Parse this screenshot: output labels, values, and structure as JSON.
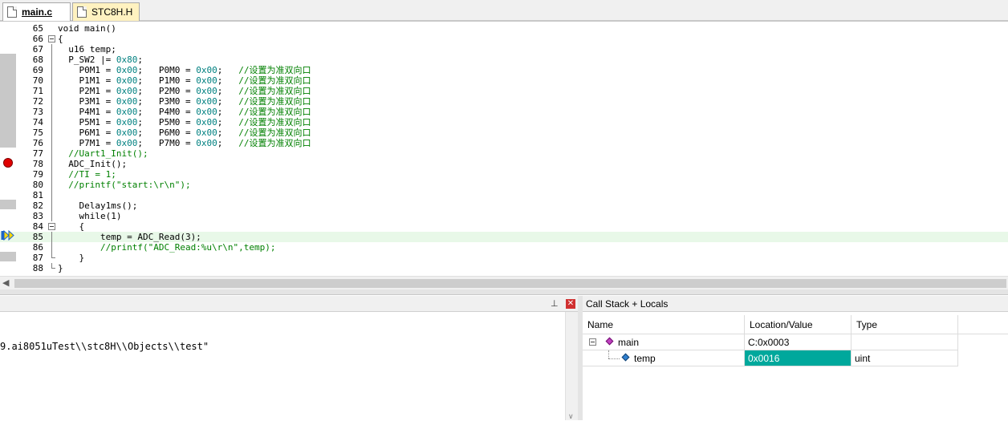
{
  "tabs": [
    {
      "label": "main.c",
      "active": true
    },
    {
      "label": "STC8H.H",
      "active": false
    }
  ],
  "editor": {
    "current_line": 85,
    "breakpoint_line": 78,
    "lines": [
      {
        "n": "65",
        "fold": "",
        "tokens": [
          [
            "n",
            "void main()"
          ]
        ]
      },
      {
        "n": "66",
        "fold": "box",
        "tokens": [
          [
            "n",
            "{"
          ]
        ]
      },
      {
        "n": "67",
        "fold": "bar",
        "tokens": [
          [
            "n",
            "  u16 temp;"
          ]
        ]
      },
      {
        "n": "68",
        "fold": "bar",
        "tokens": [
          [
            "n",
            "  P_SW2 |= "
          ],
          [
            "h",
            "0x80"
          ],
          [
            "n",
            ";"
          ]
        ]
      },
      {
        "n": "69",
        "fold": "bar",
        "tokens": [
          [
            "n",
            "    P0M1 = "
          ],
          [
            "h",
            "0x00"
          ],
          [
            "n",
            ";   P0M0 = "
          ],
          [
            "h",
            "0x00"
          ],
          [
            "n",
            ";   "
          ],
          [
            "c",
            "//设置为准双向口"
          ]
        ]
      },
      {
        "n": "70",
        "fold": "bar",
        "tokens": [
          [
            "n",
            "    P1M1 = "
          ],
          [
            "h",
            "0x00"
          ],
          [
            "n",
            ";   P1M0 = "
          ],
          [
            "h",
            "0x00"
          ],
          [
            "n",
            ";   "
          ],
          [
            "c",
            "//设置为准双向口"
          ]
        ]
      },
      {
        "n": "71",
        "fold": "bar",
        "tokens": [
          [
            "n",
            "    P2M1 = "
          ],
          [
            "h",
            "0x00"
          ],
          [
            "n",
            ";   P2M0 = "
          ],
          [
            "h",
            "0x00"
          ],
          [
            "n",
            ";   "
          ],
          [
            "c",
            "//设置为准双向口"
          ]
        ]
      },
      {
        "n": "72",
        "fold": "bar",
        "tokens": [
          [
            "n",
            "    P3M1 = "
          ],
          [
            "h",
            "0x00"
          ],
          [
            "n",
            ";   P3M0 = "
          ],
          [
            "h",
            "0x00"
          ],
          [
            "n",
            ";   "
          ],
          [
            "c",
            "//设置为准双向口"
          ]
        ]
      },
      {
        "n": "73",
        "fold": "bar",
        "tokens": [
          [
            "n",
            "    P4M1 = "
          ],
          [
            "h",
            "0x00"
          ],
          [
            "n",
            ";   P4M0 = "
          ],
          [
            "h",
            "0x00"
          ],
          [
            "n",
            ";   "
          ],
          [
            "c",
            "//设置为准双向口"
          ]
        ]
      },
      {
        "n": "74",
        "fold": "bar",
        "tokens": [
          [
            "n",
            "    P5M1 = "
          ],
          [
            "h",
            "0x00"
          ],
          [
            "n",
            ";   P5M0 = "
          ],
          [
            "h",
            "0x00"
          ],
          [
            "n",
            ";   "
          ],
          [
            "c",
            "//设置为准双向口"
          ]
        ]
      },
      {
        "n": "75",
        "fold": "bar",
        "tokens": [
          [
            "n",
            "    P6M1 = "
          ],
          [
            "h",
            "0x00"
          ],
          [
            "n",
            ";   P6M0 = "
          ],
          [
            "h",
            "0x00"
          ],
          [
            "n",
            ";   "
          ],
          [
            "c",
            "//设置为准双向口"
          ]
        ]
      },
      {
        "n": "76",
        "fold": "bar",
        "tokens": [
          [
            "n",
            "    P7M1 = "
          ],
          [
            "h",
            "0x00"
          ],
          [
            "n",
            ";   P7M0 = "
          ],
          [
            "h",
            "0x00"
          ],
          [
            "n",
            ";   "
          ],
          [
            "c",
            "//设置为准双向口"
          ]
        ]
      },
      {
        "n": "77",
        "fold": "bar",
        "tokens": [
          [
            "c",
            "  //Uart1_Init();"
          ]
        ]
      },
      {
        "n": "78",
        "fold": "bar",
        "tokens": [
          [
            "n",
            "  ADC_Init();"
          ]
        ]
      },
      {
        "n": "79",
        "fold": "bar",
        "tokens": [
          [
            "c",
            "  //TI = 1;"
          ]
        ]
      },
      {
        "n": "80",
        "fold": "bar",
        "tokens": [
          [
            "c",
            "  //printf(\"start:\\r\\n\");"
          ]
        ]
      },
      {
        "n": "81",
        "fold": "bar",
        "tokens": []
      },
      {
        "n": "82",
        "fold": "bar",
        "tokens": [
          [
            "n",
            "    Delay1ms();"
          ]
        ]
      },
      {
        "n": "83",
        "fold": "bar",
        "tokens": [
          [
            "n",
            "    while(1)"
          ]
        ]
      },
      {
        "n": "84",
        "fold": "box",
        "tokens": [
          [
            "n",
            "    {"
          ]
        ]
      },
      {
        "n": "85",
        "fold": "bar",
        "tokens": [
          [
            "n",
            "        temp = ADC_Read(3);"
          ]
        ]
      },
      {
        "n": "86",
        "fold": "bar",
        "tokens": [
          [
            "c",
            "        //printf(\"ADC_Read:%u\\r\\n\",temp);"
          ]
        ]
      },
      {
        "n": "87",
        "fold": "end",
        "tokens": [
          [
            "n",
            "    }"
          ]
        ]
      },
      {
        "n": "88",
        "fold": "end",
        "tokens": [
          [
            "n",
            "}"
          ]
        ]
      }
    ]
  },
  "output": {
    "text": "9.ai8051uTest\\\\stc8H\\\\Objects\\\\test\""
  },
  "callstack": {
    "title": "Call Stack + Locals",
    "columns": [
      "Name",
      "Location/Value",
      "Type"
    ],
    "rows": [
      {
        "name": "main",
        "value": "C:0x0003",
        "type": ""
      },
      {
        "name": "temp",
        "value": "0x0016",
        "type": "uint"
      }
    ]
  },
  "colors": {
    "hex": "#008080",
    "comment": "#008000",
    "changed_value_bg": "#00a89c",
    "breakpoint": "#e00000"
  }
}
